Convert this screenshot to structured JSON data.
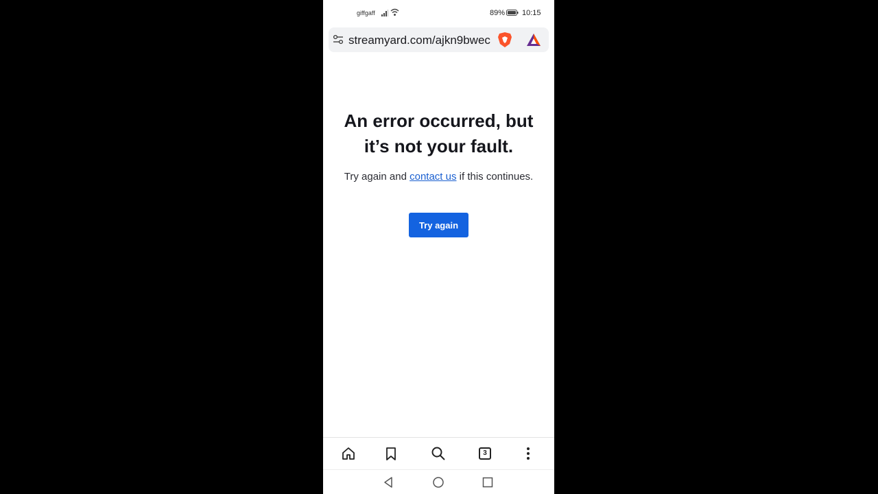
{
  "status_bar": {
    "carrier": "giffgaff",
    "battery": "89%",
    "time": "10:15"
  },
  "browser": {
    "url": "streamyard.com/ajkn9bwec",
    "tab_count": "3"
  },
  "error": {
    "title_line1": "An error occurred, but",
    "title_line2": "it’s not your fault.",
    "msg_before": "Try again and ",
    "msg_link": "contact us",
    "msg_after": " if this continues.",
    "button": "Try again"
  },
  "colors": {
    "accent": "#1463e0",
    "link": "#1a5fd0",
    "brave": "#fb542b"
  }
}
